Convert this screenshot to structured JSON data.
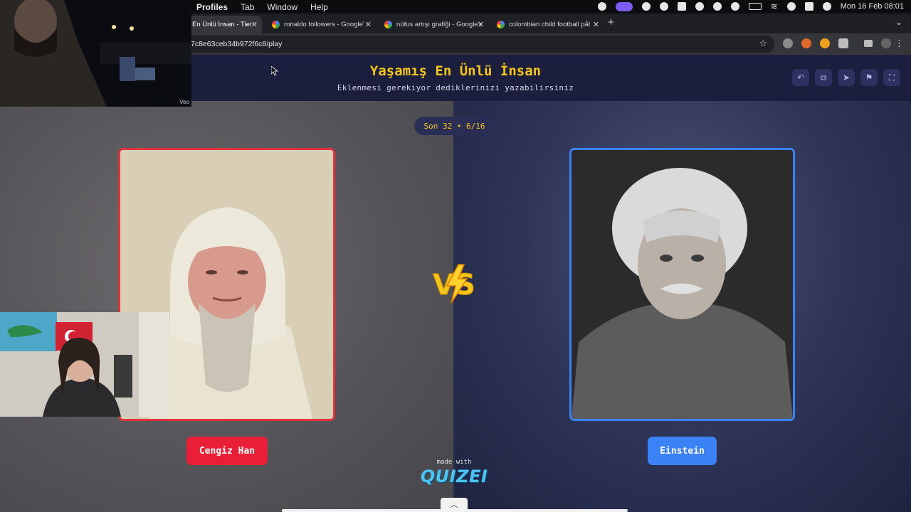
{
  "menubar": {
    "items": [
      "Profiles",
      "Tab",
      "Window",
      "Help"
    ],
    "datetime": "Mon 16 Feb  08:01"
  },
  "tabs": [
    {
      "title": "En Ünlü İnsan - Tier",
      "active": true
    },
    {
      "title": "ronaldo followers - Google'da",
      "active": false
    },
    {
      "title": "nüfus artışı grafiği - Google'da",
      "active": false
    },
    {
      "title": "colombian child football påla",
      "active": false
    }
  ],
  "address_bar": {
    "url": "7c8e63ceb34b972f6c8/play"
  },
  "page": {
    "title": "Yaşamış En Ünlü İnsan",
    "subtitle": "Eklenmesi gerekiyor dediklerinizi yazabilirsiniz",
    "round_label": "Son 32 • 6/16",
    "left": {
      "name": "Cengiz Han",
      "accent": "#e81f36"
    },
    "right": {
      "name": "Einstein",
      "accent": "#3b82f6"
    },
    "vs_text": "VS",
    "made_with": "made with",
    "brand": "QUIZEI",
    "header_icons": [
      "undo-icon",
      "copy-icon",
      "send-icon",
      "flag-icon",
      "fullscreen-icon"
    ]
  },
  "overlay": {
    "webcam_tag": "Veo"
  },
  "colors": {
    "header_bg": "#1b1e3d",
    "title": "#f5c518",
    "round_bg": "#2a2e55"
  }
}
